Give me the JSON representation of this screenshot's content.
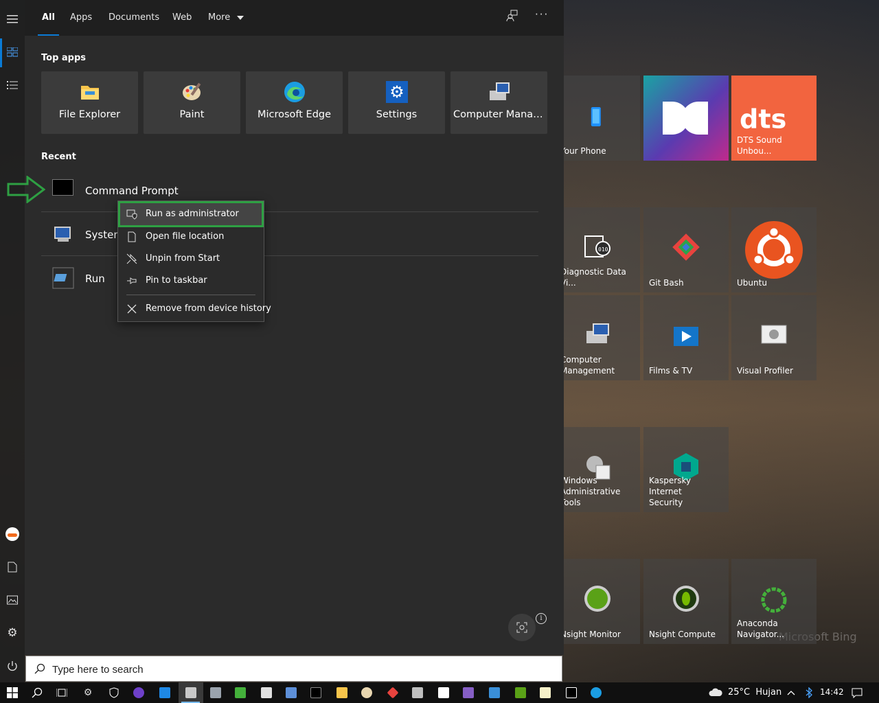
{
  "tabs": [
    {
      "label": "All"
    },
    {
      "label": "Apps"
    },
    {
      "label": "Documents"
    },
    {
      "label": "Web"
    },
    {
      "label": "More"
    }
  ],
  "sections": {
    "top_apps": "Top apps",
    "recent": "Recent"
  },
  "top_apps": [
    {
      "label": "File Explorer",
      "icon": "folder-icon"
    },
    {
      "label": "Paint",
      "icon": "palette-icon"
    },
    {
      "label": "Microsoft Edge",
      "icon": "edge-icon"
    },
    {
      "label": "Settings",
      "icon": "gear-icon"
    },
    {
      "label": "Computer Manag...",
      "icon": "computer-management-icon"
    }
  ],
  "recent": [
    {
      "label": "Command Prompt",
      "icon": "terminal-icon"
    },
    {
      "label": "System",
      "icon": "system-icon"
    },
    {
      "label": "Run",
      "icon": "run-icon"
    }
  ],
  "context_menu": [
    {
      "label": "Run as administrator",
      "icon": "shield-window-icon"
    },
    {
      "label": "Open file location",
      "icon": "file-icon"
    },
    {
      "label": "Unpin from Start",
      "icon": "unpin-icon"
    },
    {
      "label": "Pin to taskbar",
      "icon": "pin-icon"
    },
    {
      "label": "Remove from device history",
      "icon": "close-icon"
    }
  ],
  "search": {
    "placeholder": "Type here to search"
  },
  "tiles": [
    {
      "label": "Your Phone"
    },
    {
      "label": "DTS Sound Unbou..."
    },
    {
      "label": "Diagnostic Data Vi..."
    },
    {
      "label": "Git Bash"
    },
    {
      "label": "Ubuntu"
    },
    {
      "label": "Computer\nManagement"
    },
    {
      "label": "Films & TV"
    },
    {
      "label": "Visual Profiler"
    },
    {
      "label": "Windows\nAdministrative Tools"
    },
    {
      "label": "Kaspersky Internet\nSecurity"
    },
    {
      "label": "Nsight Monitor"
    },
    {
      "label": "Nsight Compute"
    },
    {
      "label": "Anaconda\nNavigator..."
    }
  ],
  "tray": {
    "weather": "25°C  Hujan",
    "time": "14:42"
  },
  "watermark": "Microsoft Bing",
  "colors": {
    "accent": "#0a7bd6",
    "highlight_outline": "#2ea043",
    "dts_tile": "#f2643f",
    "ubuntu": "#e95420"
  }
}
